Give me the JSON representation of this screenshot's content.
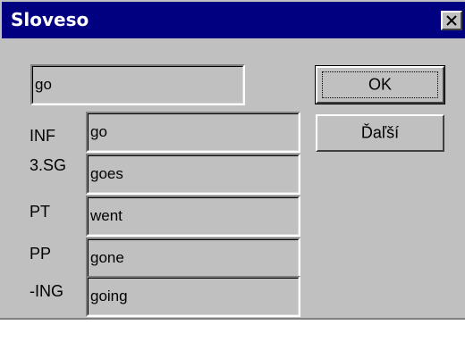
{
  "dialog": {
    "title": "Sloveso",
    "close_icon": "close-icon",
    "input": {
      "value": "go"
    },
    "buttons": {
      "ok": "OK",
      "next": "Ďaľší"
    },
    "forms": [
      {
        "label": "INF",
        "value": "go"
      },
      {
        "label": "3.SG",
        "value": "goes"
      },
      {
        "label": "PT",
        "value": "went"
      },
      {
        "label": "PP",
        "value": "gone"
      },
      {
        "label": "-ING",
        "value": "going"
      }
    ]
  }
}
